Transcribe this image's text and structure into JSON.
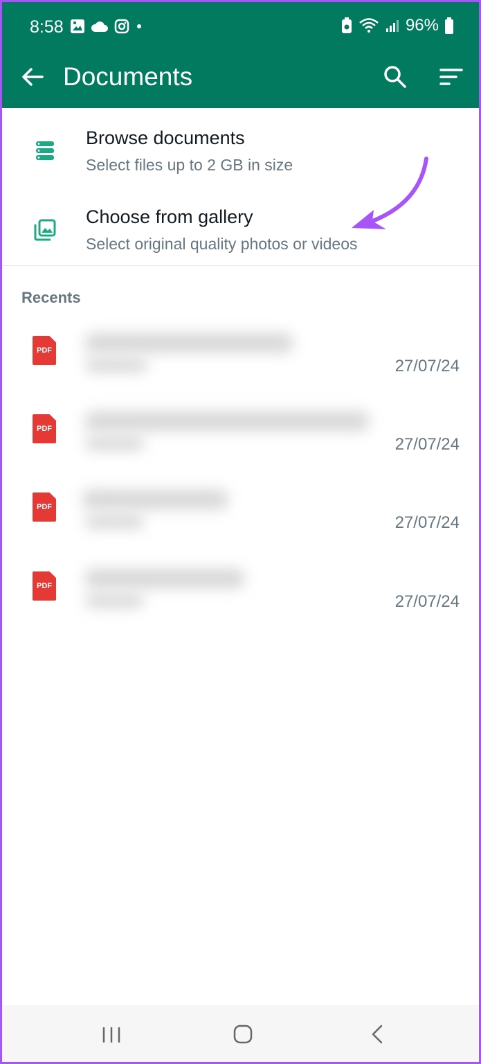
{
  "status": {
    "time": "8:58",
    "battery": "96%"
  },
  "toolbar": {
    "title": "Documents"
  },
  "options": [
    {
      "label": "Browse documents",
      "sub": "Select files up to 2 GB in size"
    },
    {
      "label": "Choose from gallery",
      "sub": "Select original quality photos or videos"
    }
  ],
  "recents": {
    "title": "Recents",
    "items": [
      {
        "icon_text": "PDF",
        "date": "27/07/24"
      },
      {
        "icon_text": "PDF",
        "date": "27/07/24"
      },
      {
        "icon_text": "PDF",
        "date": "27/07/24"
      },
      {
        "icon_text": "PDF",
        "date": "27/07/24"
      }
    ]
  },
  "colors": {
    "accent": "#017a60",
    "annotation_arrow": "#a855f7",
    "pdf_red": "#e53935"
  },
  "icons": [
    "back-arrow-icon",
    "search-icon",
    "sort-icon",
    "document-stack-icon",
    "gallery-icon",
    "pdf-icon"
  ]
}
